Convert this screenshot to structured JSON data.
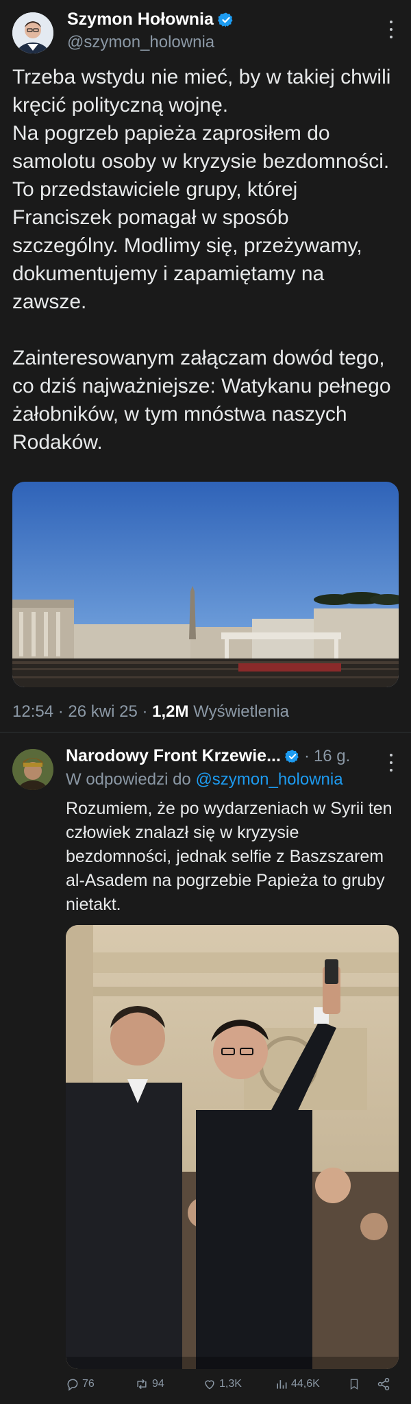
{
  "main_tweet": {
    "author": {
      "name": "Szymon Hołownia",
      "handle": "@szymon_holownia"
    },
    "text": "Trzeba wstydu nie mieć, by w takiej chwili kręcić polityczną wojnę.\nNa pogrzeb papieża zaprosiłem do samolotu osoby w kryzysie bezdomności. To przedstawiciele grupy, której Franciszek pomagał w sposób szczególny. Modlimy się, przeżywamy, dokumentujemy i zapamiętamy na zawsze.\n\nZainteresowanym załączam dowód tego, co dziś najważniejsze: Watykanu pełnego żałobników, w tym mnóstwa naszych Rodaków.",
    "time": "12:54",
    "date": "26 kwi 25",
    "sep": "·",
    "views_count": "1,2M",
    "views_label": "Wyświetlenia"
  },
  "reply": {
    "author": {
      "name": "Narodowy Front Krzewie...",
      "time": "16 g.",
      "sep": "·"
    },
    "replying_to_label": "W odpowiedzi do",
    "replying_to_handle": "@szymon_holownia",
    "text": "Rozumiem, że po wydarzeniach w Syrii ten człowiek znalazł się w kryzysie bezdomności, jednak selfie z Baszszarem al-Asadem na pogrzebie Papieża to gruby nietakt.",
    "stats": {
      "replies": "76",
      "reposts": "94",
      "likes": "1,3K",
      "views": "44,6K"
    }
  },
  "colors": {
    "background": "#1a1a1a",
    "accent": "#1d9bf0",
    "muted": "#8b98a5"
  }
}
